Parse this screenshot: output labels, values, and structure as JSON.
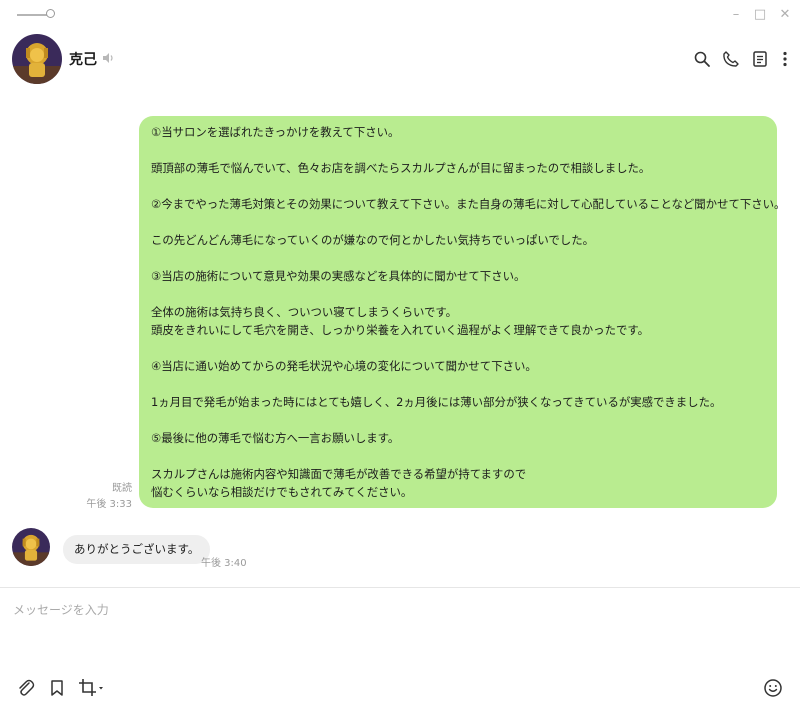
{
  "window": {
    "minimize_glyph": "–",
    "maximize_glyph": "□",
    "close_glyph": "✕"
  },
  "header": {
    "contact_name": "克己",
    "icons": [
      "search-icon",
      "phone-icon",
      "notes-icon",
      "more-icon"
    ]
  },
  "messages": {
    "sent": {
      "lines": [
        "①当サロンを選ばれたきっかけを教えて下さい。",
        "",
        "頭頂部の薄毛で悩んでいて、色々お店を調べたらスカルプさんが目に留まったので相談しました。",
        "",
        "②今までやった薄毛対策とその効果について教えて下さい。また自身の薄毛に対して心配していることなど聞かせて下さい。",
        "",
        "この先どんどん薄毛になっていくのが嫌なので何とかしたい気持ちでいっぱいでした。",
        "",
        "③当店の施術について意見や効果の実感などを具体的に聞かせて下さい。",
        "",
        "全体の施術は気持ち良く、ついつい寝てしまうくらいです。",
        "頭皮をきれいにして毛穴を開き、しっかり栄養を入れていく過程がよく理解できて良かったです。",
        "",
        "④当店に通い始めてからの発毛状況や心境の変化について聞かせて下さい。",
        "",
        "1ヵ月目で発毛が始まった時にはとても嬉しく、2ヵ月後には薄い部分が狭くなってきているが実感できました。",
        "",
        "⑤最後に他の薄毛で悩む方へ一言お願いします。",
        "",
        "スカルプさんは施術内容や知識面で薄毛が改善できる希望が持てますので",
        "悩むくらいなら相談だけでもされてみてください。"
      ],
      "read_status": "既読",
      "time": "午後 3:33",
      "bubble_color": "#b9ec90"
    },
    "received": {
      "text": "ありがとうございます。",
      "time": "午後 3:40"
    }
  },
  "composer": {
    "placeholder": "メッセージを入力",
    "value": ""
  },
  "toolbar": {
    "icons": [
      "attachment-icon",
      "bookmark-icon",
      "crop-icon",
      "emoji-icon"
    ]
  }
}
